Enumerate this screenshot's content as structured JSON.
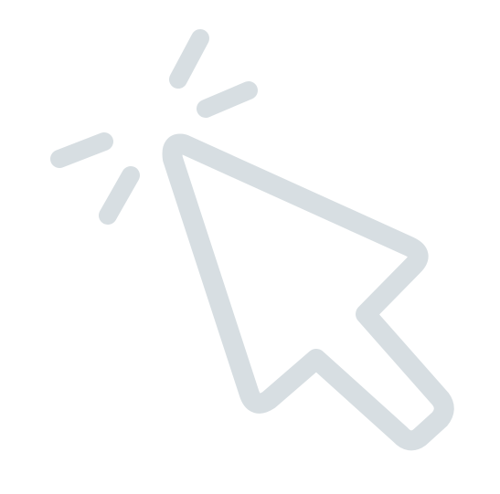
{
  "icon": {
    "name": "click-cursor-icon",
    "stroke_color": "#D7DEE2",
    "background_color": "#FFFFFF"
  }
}
